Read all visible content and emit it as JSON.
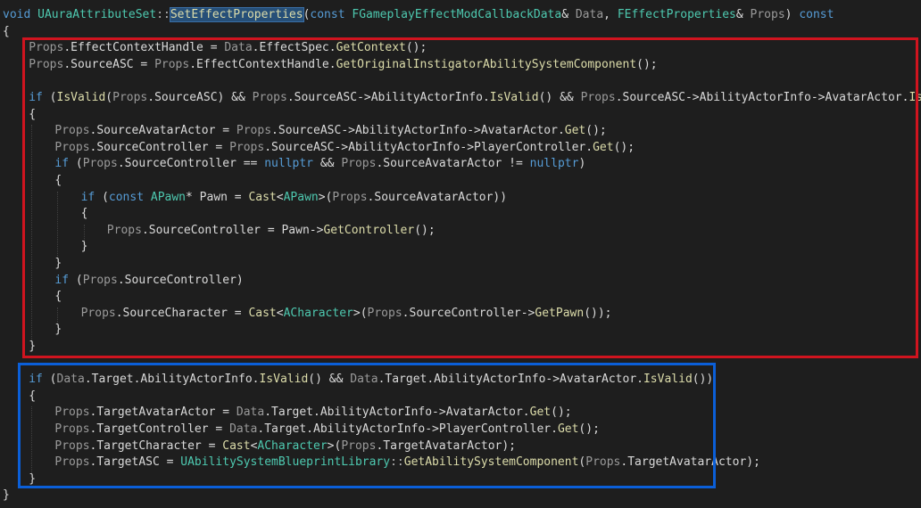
{
  "editor": {
    "colors": {
      "background": "#1e1e1e",
      "keyword": "#569cd6",
      "type": "#4ec9b0",
      "function": "#dcdcaa",
      "parameter": "#9a9a9a",
      "plain": "#dadada",
      "selection": "#264f78",
      "highlight_box_source": "#d0141f",
      "highlight_box_target": "#0b5fd8"
    },
    "lines": [
      {
        "indent": 0,
        "tokens": [
          [
            "void",
            "kw"
          ],
          [
            " ",
            "pl"
          ],
          [
            "UAuraAttributeSet",
            "ty"
          ],
          [
            "::",
            "op"
          ],
          [
            "SetEffectProperties",
            "sel"
          ],
          [
            "(",
            "pl"
          ],
          [
            "const",
            "kw"
          ],
          [
            " ",
            "pl"
          ],
          [
            "FGameplayEffectModCallbackData",
            "ty"
          ],
          [
            "& ",
            "pl"
          ],
          [
            "Data",
            "prm"
          ],
          [
            ", ",
            "pl"
          ],
          [
            "FEffectProperties",
            "ty"
          ],
          [
            "& ",
            "pl"
          ],
          [
            "Props",
            "prm"
          ],
          [
            ") ",
            "pl"
          ],
          [
            "const",
            "kw"
          ]
        ]
      },
      {
        "indent": 0,
        "tokens": [
          [
            "{",
            "pl"
          ]
        ]
      },
      {
        "indent": 1,
        "tokens": [
          [
            "Props",
            "prm"
          ],
          [
            ".EffectContextHandle = ",
            "pl"
          ],
          [
            "Data",
            "prm"
          ],
          [
            ".EffectSpec.",
            "pl"
          ],
          [
            "GetContext",
            "fn"
          ],
          [
            "();",
            "pl"
          ]
        ]
      },
      {
        "indent": 1,
        "tokens": [
          [
            "Props",
            "prm"
          ],
          [
            ".SourceASC = ",
            "pl"
          ],
          [
            "Props",
            "prm"
          ],
          [
            ".EffectContextHandle.",
            "pl"
          ],
          [
            "GetOriginalInstigatorAbilitySystemComponent",
            "fn"
          ],
          [
            "();",
            "pl"
          ]
        ]
      },
      {
        "indent": 1,
        "tokens": []
      },
      {
        "indent": 1,
        "tokens": [
          [
            "if",
            "kw"
          ],
          [
            " (",
            "pl"
          ],
          [
            "IsValid",
            "fn"
          ],
          [
            "(",
            "pl"
          ],
          [
            "Props",
            "prm"
          ],
          [
            ".SourceASC) && ",
            "pl"
          ],
          [
            "Props",
            "prm"
          ],
          [
            ".SourceASC->",
            "pl"
          ],
          [
            "AbilityActorInfo",
            "pl"
          ],
          [
            ".",
            "pl"
          ],
          [
            "IsValid",
            "fn"
          ],
          [
            "() && ",
            "pl"
          ],
          [
            "Props",
            "prm"
          ],
          [
            ".SourceASC->",
            "pl"
          ],
          [
            "AbilityActorInfo->AvatarActor.",
            "pl"
          ],
          [
            "IsValid",
            "fn"
          ],
          [
            "())",
            "pl"
          ]
        ]
      },
      {
        "indent": 1,
        "tokens": [
          [
            "{",
            "pl"
          ]
        ]
      },
      {
        "indent": 2,
        "tokens": [
          [
            "Props",
            "prm"
          ],
          [
            ".SourceAvatarActor = ",
            "pl"
          ],
          [
            "Props",
            "prm"
          ],
          [
            ".SourceASC->",
            "pl"
          ],
          [
            "AbilityActorInfo->",
            "pl"
          ],
          [
            "AvatarActor",
            "pl"
          ],
          [
            ".",
            "pl"
          ],
          [
            "Get",
            "fn"
          ],
          [
            "();",
            "pl"
          ]
        ]
      },
      {
        "indent": 2,
        "tokens": [
          [
            "Props",
            "prm"
          ],
          [
            ".SourceController = ",
            "pl"
          ],
          [
            "Props",
            "prm"
          ],
          [
            ".SourceASC->",
            "pl"
          ],
          [
            "AbilityActorInfo->PlayerController.",
            "pl"
          ],
          [
            "Get",
            "fn"
          ],
          [
            "();",
            "pl"
          ]
        ]
      },
      {
        "indent": 2,
        "tokens": [
          [
            "if",
            "kw"
          ],
          [
            " (",
            "pl"
          ],
          [
            "Props",
            "prm"
          ],
          [
            ".SourceController == ",
            "pl"
          ],
          [
            "nullptr",
            "kw"
          ],
          [
            " && ",
            "pl"
          ],
          [
            "Props",
            "prm"
          ],
          [
            ".SourceAvatarActor != ",
            "pl"
          ],
          [
            "nullptr",
            "kw"
          ],
          [
            ")",
            "pl"
          ]
        ]
      },
      {
        "indent": 2,
        "tokens": [
          [
            "{",
            "pl"
          ]
        ]
      },
      {
        "indent": 3,
        "tokens": [
          [
            "if",
            "kw"
          ],
          [
            " (",
            "pl"
          ],
          [
            "const",
            "kw"
          ],
          [
            " ",
            "pl"
          ],
          [
            "APawn",
            "ty"
          ],
          [
            "* ",
            "pl"
          ],
          [
            "Pawn",
            "pl"
          ],
          [
            " = ",
            "pl"
          ],
          [
            "Cast",
            "fn"
          ],
          [
            "<",
            "pl"
          ],
          [
            "APawn",
            "ty"
          ],
          [
            ">(",
            "pl"
          ],
          [
            "Props",
            "prm"
          ],
          [
            ".SourceAvatarActor))",
            "pl"
          ]
        ]
      },
      {
        "indent": 3,
        "tokens": [
          [
            "{",
            "pl"
          ]
        ]
      },
      {
        "indent": 4,
        "tokens": [
          [
            "Props",
            "prm"
          ],
          [
            ".SourceController = ",
            "pl"
          ],
          [
            "Pawn",
            "pl"
          ],
          [
            "->",
            "pl"
          ],
          [
            "GetController",
            "fn"
          ],
          [
            "();",
            "pl"
          ]
        ]
      },
      {
        "indent": 3,
        "tokens": [
          [
            "}",
            "pl"
          ]
        ]
      },
      {
        "indent": 2,
        "tokens": [
          [
            "}",
            "pl"
          ]
        ]
      },
      {
        "indent": 2,
        "tokens": [
          [
            "if",
            "kw"
          ],
          [
            " (",
            "pl"
          ],
          [
            "Props",
            "prm"
          ],
          [
            ".SourceController)",
            "pl"
          ]
        ]
      },
      {
        "indent": 2,
        "tokens": [
          [
            "{",
            "pl"
          ]
        ]
      },
      {
        "indent": 3,
        "tokens": [
          [
            "Props",
            "prm"
          ],
          [
            ".SourceCharacter = ",
            "pl"
          ],
          [
            "Cast",
            "fn"
          ],
          [
            "<",
            "pl"
          ],
          [
            "ACharacter",
            "ty"
          ],
          [
            ">(",
            "pl"
          ],
          [
            "Props",
            "prm"
          ],
          [
            ".SourceController->",
            "pl"
          ],
          [
            "GetPawn",
            "fn"
          ],
          [
            "());",
            "pl"
          ]
        ]
      },
      {
        "indent": 2,
        "tokens": [
          [
            "}",
            "pl"
          ]
        ]
      },
      {
        "indent": 1,
        "tokens": [
          [
            "}",
            "pl"
          ]
        ]
      },
      {
        "indent": 1,
        "tokens": []
      },
      {
        "indent": 1,
        "tokens": [
          [
            "if",
            "kw"
          ],
          [
            " (",
            "pl"
          ],
          [
            "Data",
            "prm"
          ],
          [
            ".Target.AbilityActorInfo.",
            "pl"
          ],
          [
            "IsValid",
            "fn"
          ],
          [
            "() && ",
            "pl"
          ],
          [
            "Data",
            "prm"
          ],
          [
            ".Target.AbilityActorInfo->AvatarActor.",
            "pl"
          ],
          [
            "IsValid",
            "fn"
          ],
          [
            "())",
            "pl"
          ]
        ]
      },
      {
        "indent": 1,
        "tokens": [
          [
            "{",
            "pl"
          ]
        ]
      },
      {
        "indent": 2,
        "tokens": [
          [
            "Props",
            "prm"
          ],
          [
            ".TargetAvatarActor = ",
            "pl"
          ],
          [
            "Data",
            "prm"
          ],
          [
            ".Target.AbilityActorInfo->AvatarActor.",
            "pl"
          ],
          [
            "Get",
            "fn"
          ],
          [
            "();",
            "pl"
          ]
        ]
      },
      {
        "indent": 2,
        "tokens": [
          [
            "Props",
            "prm"
          ],
          [
            ".TargetController = ",
            "pl"
          ],
          [
            "Data",
            "prm"
          ],
          [
            ".Target.AbilityActorInfo->PlayerController.",
            "pl"
          ],
          [
            "Get",
            "fn"
          ],
          [
            "();",
            "pl"
          ]
        ]
      },
      {
        "indent": 2,
        "tokens": [
          [
            "Props",
            "prm"
          ],
          [
            ".TargetCharacter = ",
            "pl"
          ],
          [
            "Cast",
            "fn"
          ],
          [
            "<",
            "pl"
          ],
          [
            "ACharacter",
            "ty"
          ],
          [
            ">(",
            "pl"
          ],
          [
            "Props",
            "prm"
          ],
          [
            ".TargetAvatarActor);",
            "pl"
          ]
        ]
      },
      {
        "indent": 2,
        "tokens": [
          [
            "Props",
            "prm"
          ],
          [
            ".TargetASC = ",
            "pl"
          ],
          [
            "UAbilitySystemBlueprintLibrary",
            "ty"
          ],
          [
            "::",
            "op"
          ],
          [
            "GetAbilitySystemComponent",
            "fn"
          ],
          [
            "(",
            "pl"
          ],
          [
            "Props",
            "prm"
          ],
          [
            ".TargetAvatarActor);",
            "pl"
          ]
        ]
      },
      {
        "indent": 1,
        "tokens": [
          [
            "}",
            "pl"
          ]
        ]
      },
      {
        "indent": 0,
        "tokens": [
          [
            "}",
            "pl"
          ]
        ]
      }
    ]
  }
}
